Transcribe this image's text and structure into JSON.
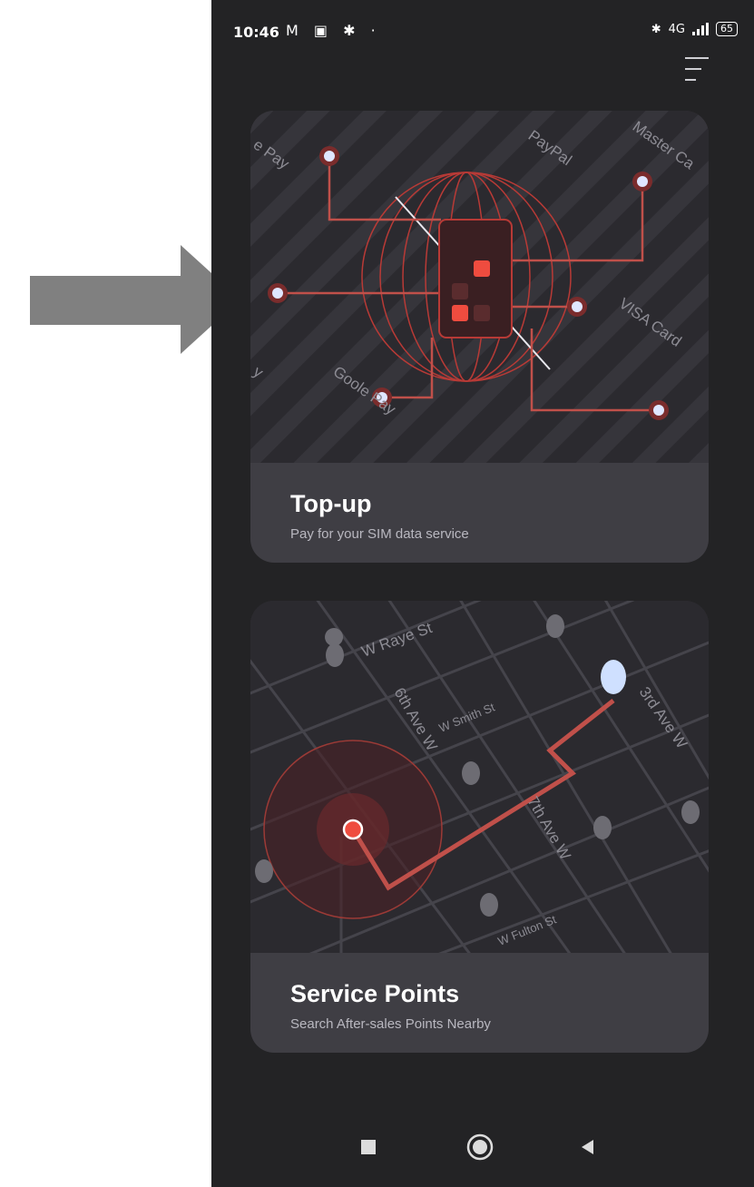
{
  "status_bar": {
    "time": "10:46",
    "notif_icons": "M ▣ ✱ ·",
    "network": "4G",
    "battery": "65"
  },
  "cards": [
    {
      "title": "Top-up",
      "subtitle": "Pay for your SIM data service",
      "art_labels": [
        "e Pay",
        "PayPal",
        "Master Ca",
        "VISA Card",
        "Goole Pay",
        "y"
      ]
    },
    {
      "title": "Service Points",
      "subtitle": "Search After-sales Points Nearby",
      "streets": [
        "W Raye St",
        "6th Ave W",
        "W Smith St",
        "3rd Ave W",
        "7th Ave W",
        "W Fulton St"
      ]
    }
  ],
  "colors": {
    "accent": "#e2483f",
    "background": "#232325",
    "card": "#3f3e44",
    "arrow": "#808080"
  }
}
